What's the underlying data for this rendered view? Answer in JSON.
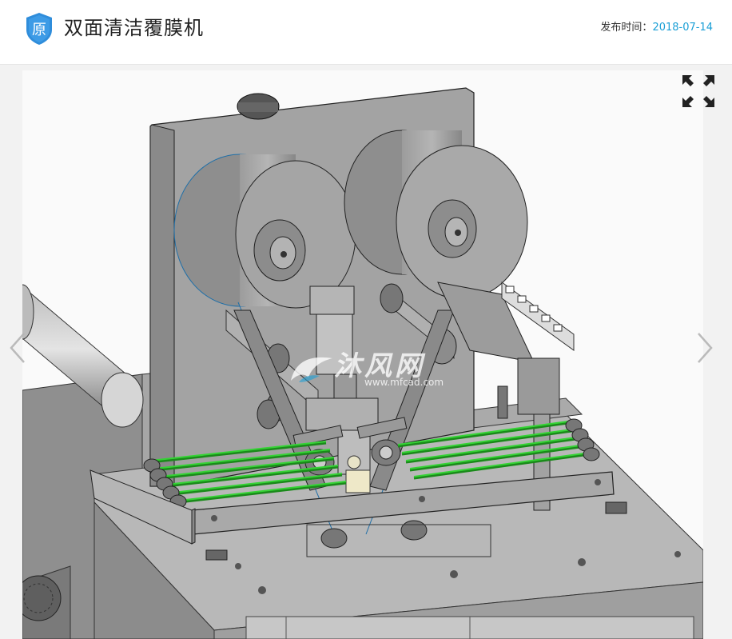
{
  "header": {
    "badge_char": "原",
    "title": "双面清洁覆膜机",
    "publish_label": "发布时间：",
    "publish_date": "2018-07-14"
  },
  "viewer": {
    "watermark_text": "沐风网",
    "watermark_url": "www.mfcad.com",
    "image_subject": "CAD model render of double-sided cleaning laminating machine"
  },
  "icons": {
    "badge": "shield-icon",
    "expand": "fullscreen-icon",
    "prev": "chevron-left-icon",
    "next": "chevron-right-icon"
  },
  "colors": {
    "accent": "#1a9fd6",
    "badge": "#2f8ddb",
    "roller_green": "#35d335",
    "machine_gray": "#9a9a9a"
  }
}
